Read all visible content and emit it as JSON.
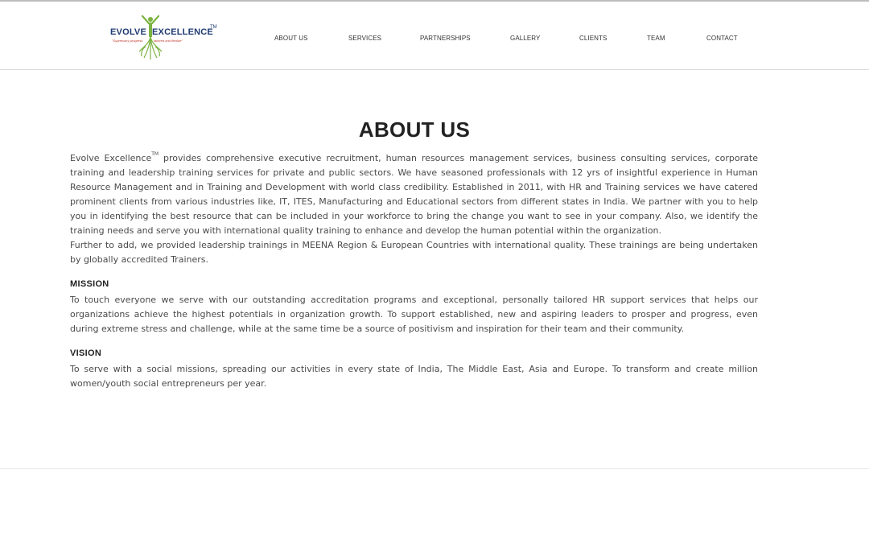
{
  "brand": {
    "word1": "EVOLVE",
    "word2": "EXCELLENCE",
    "trademark": "TM",
    "tagline_left": "\"Supremacy progress",
    "tagline_right": "tailored and flexible\"",
    "logo_icon": "tree-figure-icon"
  },
  "nav": {
    "items": [
      {
        "label": "ABOUT US"
      },
      {
        "label": "SERVICES"
      },
      {
        "label": "PARTNERSHIPS"
      },
      {
        "label": "GALLERY"
      },
      {
        "label": "CLIENTS"
      },
      {
        "label": "TEAM"
      },
      {
        "label": "CONTACT"
      }
    ]
  },
  "page": {
    "title": "ABOUT US",
    "intro": {
      "lead": "Evolve Excellence",
      "tm": "TM",
      "text": " provides comprehensive executive recruitment, human resources management services, business consulting services, corporate training and leadership training services for private and public sectors. We have seasoned professionals with 12 yrs of insightful experience in Human Resource Management and in Training and Development with world class credibility. Established in 2011, with HR and Training services we have catered prominent clients from various industries like, IT, ITES, Manufacturing and Educational sectors from different states in India. We partner with you to help you in identifying the best resource that can be included in your workforce to bring the change you want to see in your company. Also, we identify the training needs and serve you with international quality training to enhance and develop the human potential within the organization.",
      "further": "Further to add, we provided leadership trainings in MEENA Region & European Countries with international quality. These trainings are being undertaken by globally accredited Trainers."
    },
    "mission": {
      "heading": "MISSION",
      "text": "To touch everyone we serve with our outstanding accreditation programs and exceptional, personally tailored HR support services that helps our organizations achieve the highest potentials in organization growth. To support established, new and aspiring leaders to prosper and progress, even during extreme stress and challenge, while at the same time be a source of positivism and inspiration for their team and their community."
    },
    "vision": {
      "heading": "VISION",
      "text": "To serve with a social missions, spreading our activities in every state of India, The Middle East, Asia and Europe. To transform and create million women/youth social entrepreneurs per year."
    }
  },
  "colors": {
    "brand_blue": "#1f3b73",
    "brand_green": "#7cb342",
    "text": "#4a4a4a",
    "heading": "#222222"
  }
}
